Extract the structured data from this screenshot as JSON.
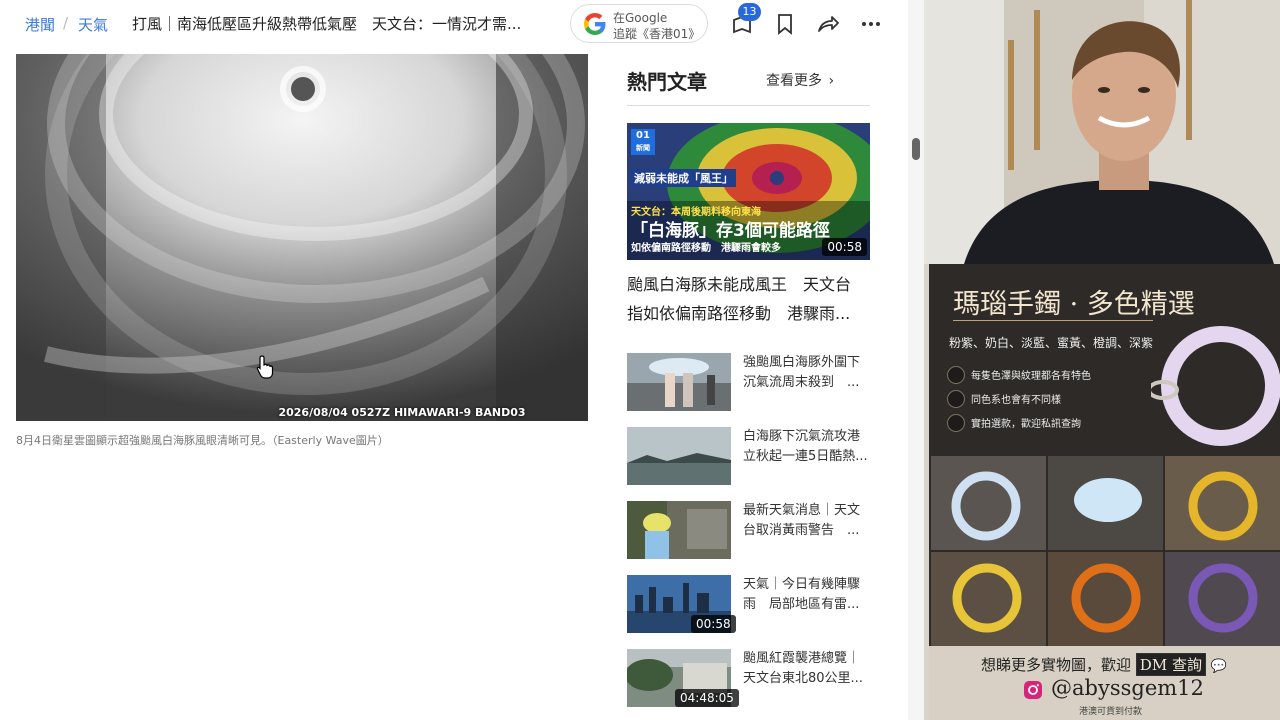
{
  "breadcrumb": {
    "first": "港聞",
    "separator": "/",
    "second": "天氣"
  },
  "headline": "打風｜南海低壓區升級熱帶低氣壓　天文台：一情況才需...",
  "google_follow": {
    "line1": "在Google",
    "line2": "追蹤《香港01》"
  },
  "toolbar": {
    "badge_count": "13"
  },
  "article": {
    "image_stamp": "2026/08/04 0527Z HIMAWARI-9 BAND03",
    "caption": "8月4日衛星雲圖顯示超強颱風白海豚風眼清晰可見。（Easterly Wave圖片）"
  },
  "hot": {
    "title": "熱門文章",
    "more": "查看更多",
    "feature": {
      "logo_text": "01",
      "logo_sub": "新聞",
      "overlay_1": "減弱未能成「風王」",
      "overlay_2": "天文台：本周後期料移向東海",
      "overlay_3": "「白海豚」存3個可能路徑",
      "overlay_4": "如依偏南路徑移動　港驟雨會較多",
      "duration": "00:58",
      "title_line1": "颱風白海豚未能成風王　天文台",
      "title_line2": "指如依偏南路徑移動　港驟雨..."
    },
    "items": [
      {
        "line1": "強颱風白海豚外圍下",
        "line2": "沉氣流周末殺到　...",
        "duration": ""
      },
      {
        "line1": "白海豚下沉氣流攻港",
        "line2": "立秋起一連5日酷熱...",
        "duration": ""
      },
      {
        "line1": "最新天氣消息｜天文",
        "line2": "台取消黃雨警告　...",
        "duration": ""
      },
      {
        "line1": "天氣｜今日有幾陣驟",
        "line2": "雨　局部地區有雷...",
        "duration": "00:58"
      },
      {
        "line1": "颱風紅霞襲港總覽｜",
        "line2": "天文台東北80公里...",
        "duration": "04:48:05"
      }
    ]
  },
  "ad": {
    "title": "瑪瑙手鐲 · 多色精選",
    "subtitle": "粉紫、奶白、淡藍、蜜黃、橙調、深紫",
    "features": [
      "每隻色澤與紋理都各有特色",
      "同色系也會有不同樣",
      "實拍選款，歡迎私訊查詢"
    ],
    "footer_prefix": "想睇更多實物圖，歡迎",
    "footer_dm": "DM 查詢",
    "handle": "@abyssgem12",
    "footer_small": "港澳可貨到付款"
  }
}
